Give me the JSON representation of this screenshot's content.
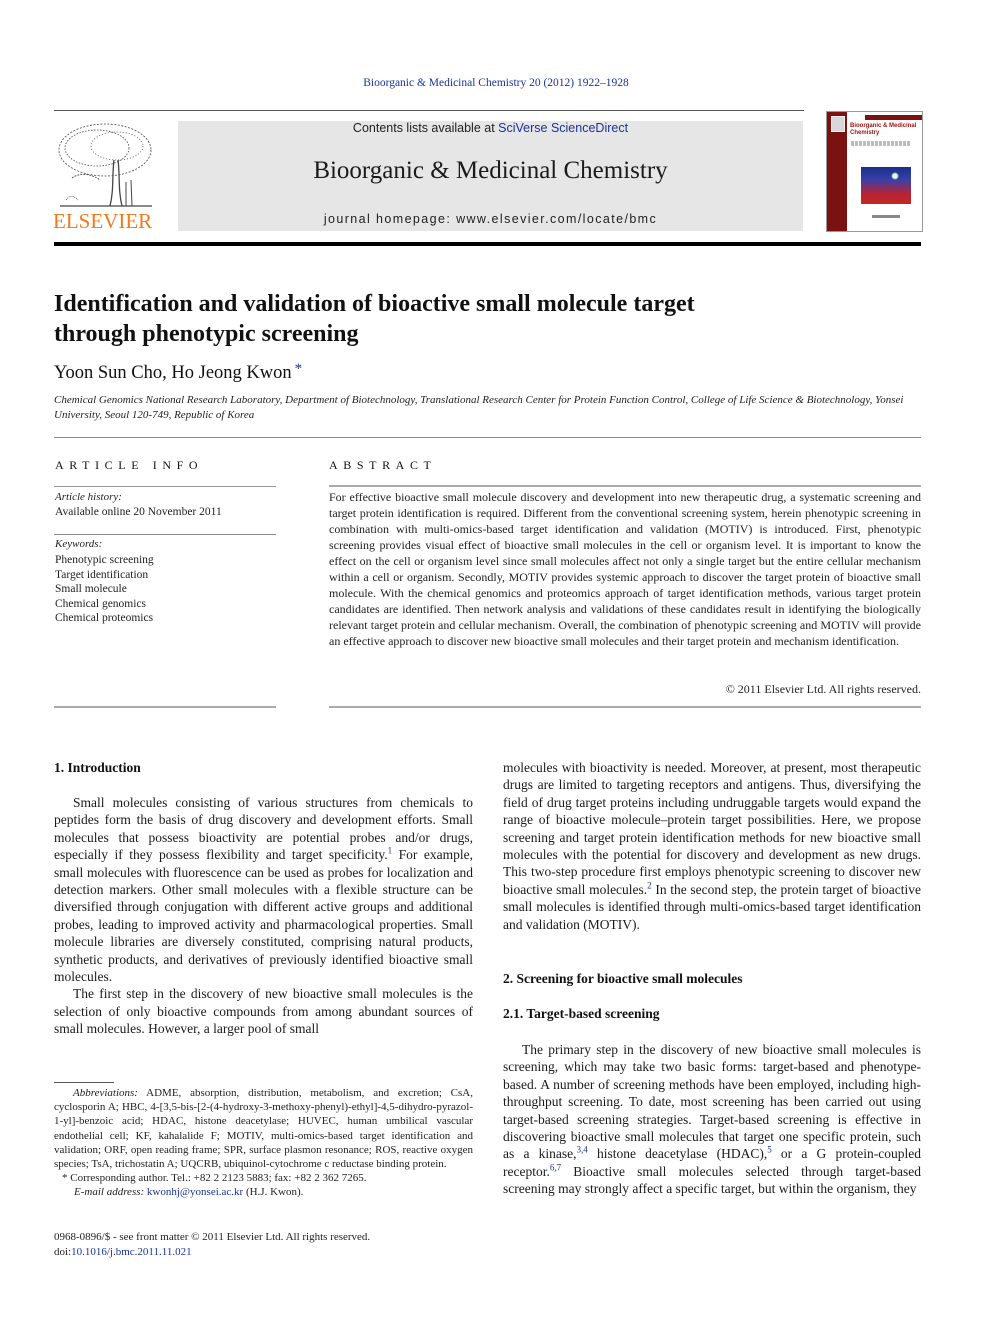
{
  "journal_ref": "Bioorganic & Medicinal Chemistry 20 (2012) 1922–1928",
  "header": {
    "publisher_logo_text": "ELSEVIER",
    "contents_prefix": "Contents lists available at ",
    "contents_link": "SciVerse ScienceDirect",
    "journal_title": "Bioorganic & Medicinal Chemistry",
    "homepage": "journal homepage: www.elsevier.com/locate/bmc",
    "cover_title": "Bioorganic & Medicinal Chemistry"
  },
  "article": {
    "title_line1": "Identification and validation of bioactive small molecule target",
    "title_line2": "through phenotypic screening",
    "authors": "Yoon Sun Cho, Ho Jeong Kwon",
    "author_marker": "*",
    "affiliation": "Chemical Genomics National Research Laboratory, Department of Biotechnology, Translational Research Center for Protein Function Control, College of Life Science & Biotechnology, Yonsei University, Seoul 120-749, Republic of Korea"
  },
  "article_info": {
    "heading": "ARTICLE INFO",
    "history_label": "Article history:",
    "history_value": "Available online 20 November 2011",
    "keywords_label": "Keywords:",
    "keywords": [
      "Phenotypic screening",
      "Target identification",
      "Small molecule",
      "Chemical genomics",
      "Chemical proteomics"
    ]
  },
  "abstract": {
    "heading": "ABSTRACT",
    "text": "For effective bioactive small molecule discovery and development into new therapeutic drug, a systematic screening and target protein identification is required. Different from the conventional screening system, herein phenotypic screening in combination with multi-omics-based target identification and validation (MOTIV) is introduced. First, phenotypic screening provides visual effect of bioactive small molecules in the cell or organism level. It is important to know the effect on the cell or organism level since small molecules affect not only a single target but the entire cellular mechanism within a cell or organism. Secondly, MOTIV provides systemic approach to discover the target protein of bioactive small molecule. With the chemical genomics and proteomics approach of target identification methods, various target protein candidates are identified. Then network analysis and validations of these candidates result in identifying the biologically relevant target protein and cellular mechanism. Overall, the combination of phenotypic screening and MOTIV will provide an effective approach to discover new bioactive small molecules and their target protein and mechanism identification.",
    "copyright": "© 2011 Elsevier Ltd. All rights reserved."
  },
  "body": {
    "section1_heading": "1. Introduction",
    "p1_a": "Small molecules consisting of various structures from chemicals to peptides form the basis of drug discovery and development efforts. Small molecules that possess bioactivity are potential probes and/or drugs, especially if they possess flexibility and target specificity.",
    "p1_ref": "1",
    "p1_b": " For example, small molecules with fluorescence can be used as probes for localization and detection markers. Other small molecules with a flexible structure can be diversified through conjugation with different active groups and additional probes, leading to improved activity and pharmacological properties. Small molecule libraries are diversely constituted, comprising natural products, synthetic products, and derivatives of previously identified bioactive small molecules.",
    "p2": "The first step in the discovery of new bioactive small molecules is the selection of only bioactive compounds from among abundant sources of small molecules. However, a larger pool of small",
    "p2_cont_a": "molecules with bioactivity is needed. Moreover, at present, most therapeutic drugs are limited to targeting receptors and antigens. Thus, diversifying the field of drug target proteins including undruggable targets would expand the range of bioactive molecule–protein target possibilities. Here, we propose screening and target protein identification methods for new bioactive small molecules with the potential for discovery and development as new drugs. This two-step procedure first employs phenotypic screening to discover new bioactive small molecules.",
    "p2_ref": "2",
    "p2_cont_b": " In the second step, the protein target of bioactive small molecules is identified through multi-omics-based target identification and validation (MOTIV).",
    "section2_heading": "2. Screening for bioactive small molecules",
    "section21_heading": "2.1. Target-based screening",
    "p3_a": "The primary step in the discovery of new bioactive small molecules is screening, which may take two basic forms: target-based and phenotype-based. A number of screening methods have been employed, including high-throughput screening. To date, most screening has been carried out using target-based screening strategies. Target-based screening is effective in discovering bioactive small molecules that target one specific protein, such as a kinase,",
    "p3_ref1": "3,4",
    "p3_b": " histone deacetylase (HDAC),",
    "p3_ref2": "5",
    "p3_c": " or a G protein-coupled receptor.",
    "p3_ref3": "6,7",
    "p3_d": " Bioactive small molecules selected through target-based screening may strongly affect a specific target, but within the organism, they"
  },
  "footnotes": {
    "abbrev_label": "Abbreviations:",
    "abbrev_text": " ADME, absorption, distribution, metabolism, and excretion; CsA, cyclosporin A; HBC, 4-[3,5-bis-[2-(4-hydroxy-3-methoxy-phenyl)-ethyl]-4,5-dihydro-pyrazol-1-yl]-benzoic acid; HDAC, histone deacetylase; HUVEC, human umbilical vascular endothelial cell; KF, kahalalide F; MOTIV, multi-omics-based target identification and validation; ORF, open reading frame; SPR, surface plasmon resonance; ROS, reactive oxygen species; TsA, trichostatin A; UQCRB, ubiquinol-cytochrome c reductase binding protein.",
    "corresponding": "* Corresponding author. Tel.: +82 2 2123 5883; fax: +82 2 362 7265.",
    "email_label": "E-mail address: ",
    "email": "kwonhj@yonsei.ac.kr",
    "email_suffix": " (H.J. Kwon).",
    "issn_line": "0968-0896/$ - see front matter © 2011 Elsevier Ltd. All rights reserved.",
    "doi_prefix": "doi:",
    "doi": "10.1016/j.bmc.2011.11.021"
  },
  "colors": {
    "link": "#1a3399",
    "elsevier_orange": "#f07a1c",
    "banner_grey": "#e6e6e6",
    "cover_red": "#7a1212"
  }
}
